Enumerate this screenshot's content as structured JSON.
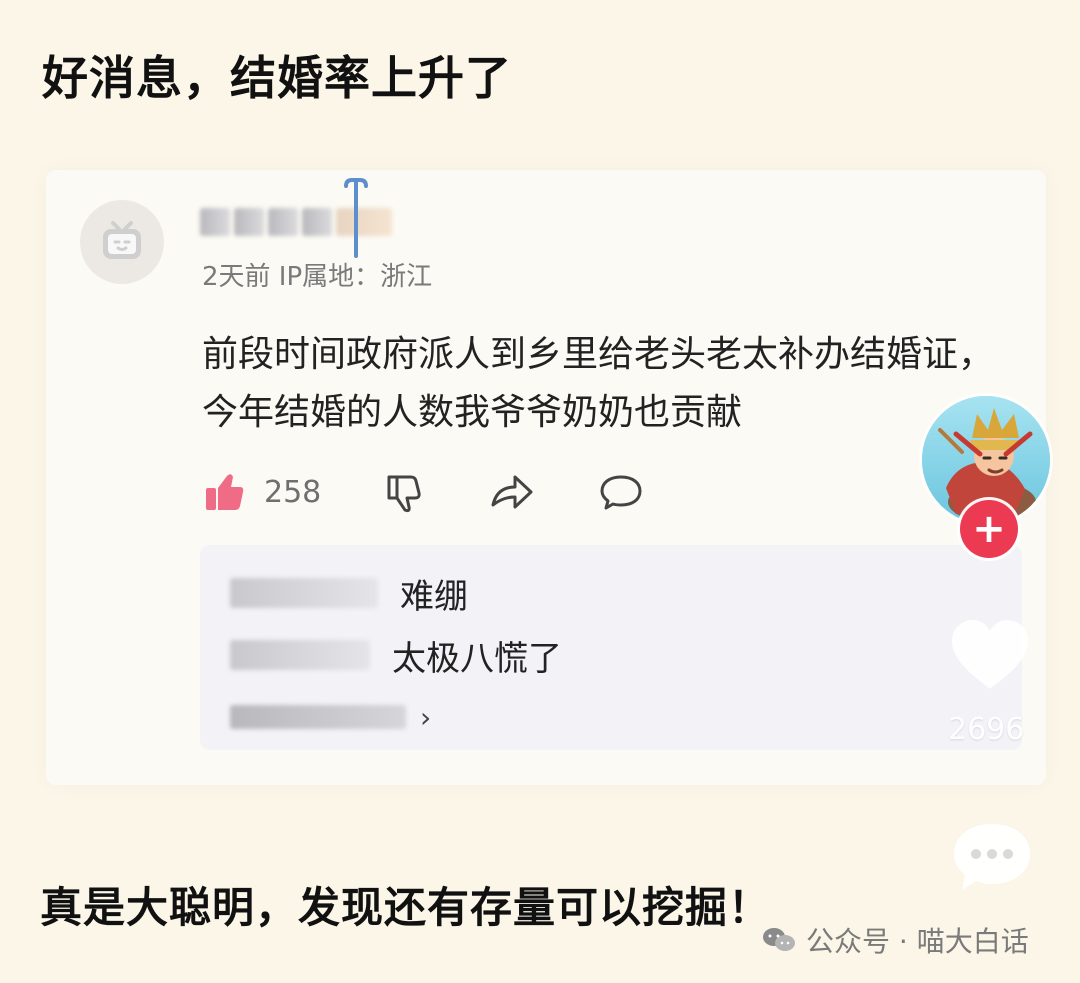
{
  "page": {
    "headline": "好消息，结婚率上升了",
    "bottom_text": "真是大聪明，发现还有存量可以挖掘！"
  },
  "comment": {
    "meta": "2天前 IP属地：浙江",
    "text": "前段时间政府派人到乡里给老头老太补办结婚证，今年结婚的人数我爷爷奶奶也贡献",
    "likes": "258"
  },
  "replies": {
    "items": [
      {
        "text": "难绷"
      },
      {
        "text": "太极八慌了"
      }
    ],
    "more_arrow": "›"
  },
  "right_rail": {
    "heart_count": "2696"
  },
  "watermark": {
    "text": "公众号 · 喵大白话"
  },
  "colors": {
    "background": "#fbf6e8",
    "accent_red": "#ec3a52",
    "like_pink": "#ef6b86"
  },
  "icons": {
    "avatar": "bilibili-tv-icon",
    "like": "thumbs-up-icon",
    "dislike": "thumbs-down-icon",
    "share": "share-arrow-icon",
    "comment": "comment-bubble-icon",
    "follow": "plus-icon",
    "heart": "heart-icon",
    "more": "ellipsis-bubble-icon",
    "watermark": "wechat-icon"
  }
}
